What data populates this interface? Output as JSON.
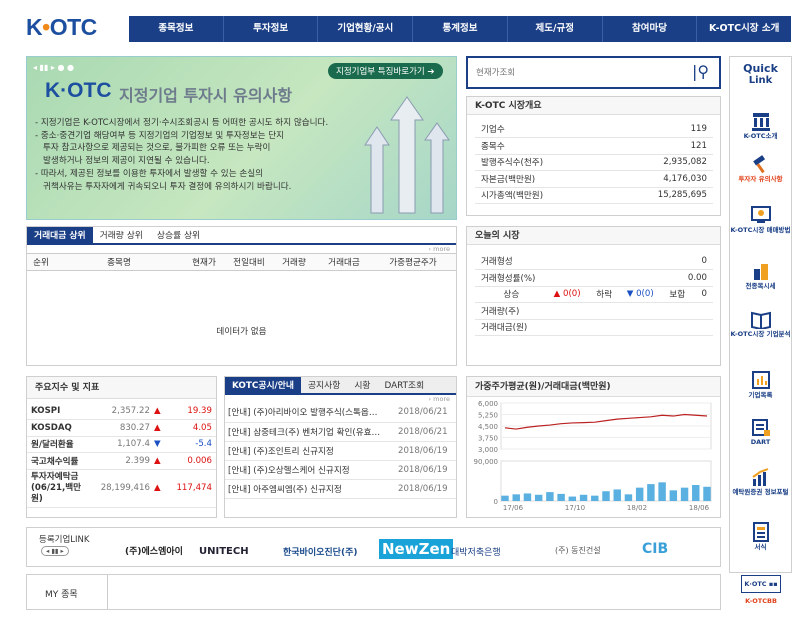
{
  "logo": {
    "text1": "K",
    "text2": "OTC"
  },
  "nav": [
    "종목정보",
    "투자정보",
    "기업현황/공시",
    "통계정보",
    "제도/규정",
    "참여마당",
    "K-OTC시장 소개"
  ],
  "banner": {
    "button": "지정기업부 특징바로가기 ➔",
    "logo": "K·OTC",
    "title": "지정기업 투자시 유의사항",
    "lines": [
      "- 지정기업은 K-OTC시장에서 정기·수시조회공시 등 어떠한 공시도 하지 않습니다.",
      "- 중소·중견기업 해당여부 등 지정기업의 기업정보 및 투자정보는 단지",
      "  투자 참고사항으로 제공되는 것으로, 불가피한 오류 또는 누락이",
      "  발생하거나 정보의 제공이 지연될 수 있습니다.",
      "- 따라서, 제공된 정보를 이용한 투자에서 발생할 수 있는 손실의",
      "  귀책사유는 투자자에게 귀속되오니 투자 결정에 유의하시기 바랍니다."
    ]
  },
  "search": {
    "placeholder": "현재가조회"
  },
  "overview": {
    "title": "K-OTC 시장개요",
    "rows": [
      [
        "기업수",
        "119"
      ],
      [
        "종목수",
        "121"
      ],
      [
        "발행주식수(천주)",
        "2,935,082"
      ],
      [
        "자본금(백만원)",
        "4,176,030"
      ],
      [
        "시가총액(백만원)",
        "15,285,695"
      ]
    ]
  },
  "ranking": {
    "tabs": [
      "거래대금 상위",
      "거래량 상위",
      "상승률 상위"
    ],
    "more": "› more",
    "headers": [
      "순위",
      "종목명",
      "현재가",
      "전일대비",
      "거래량",
      "거래대금",
      "가중평균주가"
    ],
    "empty": "데이터가 없음"
  },
  "today": {
    "title": "오늘의 시장",
    "rows": [
      [
        "거래형성",
        "0"
      ],
      [
        "거래형성률(%)",
        "0.00"
      ]
    ],
    "rise_label": "상승",
    "rise_val": "0(0)",
    "fall_label": "하락",
    "fall_val": "0(0)",
    "flat_label": "보합",
    "flat_val": "0",
    "vol_label": "거래량(주)",
    "amt_label": "거래대금(원)"
  },
  "indices": {
    "title": "주요지수 및 지표",
    "rows": [
      {
        "name": "KOSPI",
        "val": "2,357.22",
        "dir": "up",
        "chg": "19.39"
      },
      {
        "name": "KOSDAQ",
        "val": "830.27",
        "dir": "up",
        "chg": "4.05"
      },
      {
        "name": "원/달러환율",
        "val": "1,107.4",
        "dir": "dn",
        "chg": "-5.4"
      },
      {
        "name": "국고채수익률",
        "val": "2.399",
        "dir": "up",
        "chg": "0.006"
      },
      {
        "name": "투자자예탁금 (06/21,백만원)",
        "val": "28,199,416",
        "dir": "up",
        "chg": "117,474"
      }
    ]
  },
  "notices": {
    "tabs": [
      "KOTC공시/안내",
      "공지사항",
      "시황",
      "DART조회"
    ],
    "more": "› more",
    "rows": [
      [
        "[안내] (주)아리바이오 발행주식(스톡옵…",
        "2018/06/21"
      ],
      [
        "[안내] 삼중테크(주) 벤처기업 확인(유효…",
        "2018/06/21"
      ],
      [
        "[안내] (주)조인트리 신규지정",
        "2018/06/19"
      ],
      [
        "[안내] (주)오상헬스케어 신규지정",
        "2018/06/19"
      ],
      [
        "[안내] 아주엠씨엠(주) 신규지정",
        "2018/06/19"
      ]
    ]
  },
  "chart_data": {
    "type": "line",
    "title": "가중주가평균(원)/거래대금(백만원)",
    "x_ticks": [
      "17/06",
      "17/10",
      "18/02",
      "18/06"
    ],
    "line": {
      "ylim": [
        3000,
        6000
      ],
      "y_ticks": [
        "6,000",
        "5,250",
        "4,500",
        "3,750",
        "3,000"
      ],
      "values": [
        4380,
        4300,
        4420,
        4500,
        4560,
        4650,
        4700,
        4720,
        4750,
        4850,
        4950,
        5000,
        5050,
        5100,
        5200,
        5150,
        5250,
        5200,
        5150
      ]
    },
    "bars": {
      "ylim": [
        0,
        90000
      ],
      "y_ticks": [
        "90,000",
        "0"
      ],
      "values": [
        12000,
        15000,
        17000,
        14000,
        20000,
        16000,
        10000,
        14000,
        12000,
        22000,
        26000,
        15000,
        30000,
        38000,
        42000,
        24000,
        30000,
        36000,
        32000
      ]
    }
  },
  "links": {
    "title": "등록기업LINK",
    "companies": [
      "(주)에스엠아이",
      "UNITECH",
      "한국바이오진단(주)",
      "NewZen",
      "대박저축은행",
      "(주) 동진건설",
      "CIB"
    ]
  },
  "my": {
    "title": "MY 종목"
  },
  "quick": {
    "title1": "Quick",
    "title2": "Link",
    "items": [
      "K-OTC소개",
      "투자자 유의사항",
      "K-OTC시장 매매방법",
      "전종목시세",
      "K-OTC시장 기업분석",
      "기업목록",
      "DART",
      "예탁원증권 정보포털",
      "서식",
      "K-OTCBB"
    ]
  }
}
